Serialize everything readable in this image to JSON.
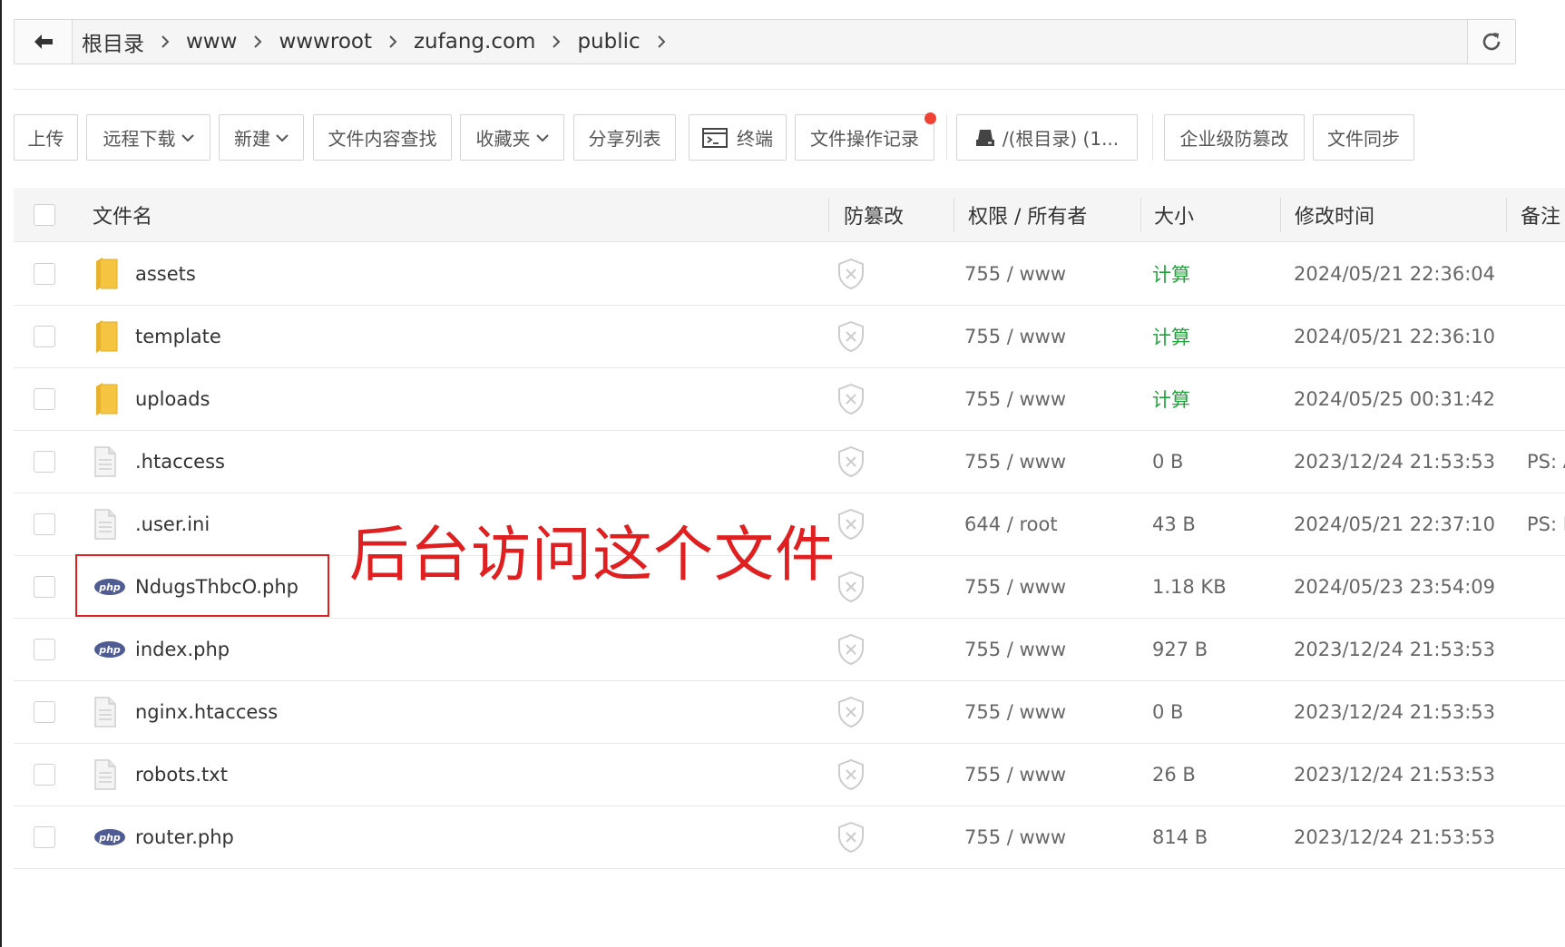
{
  "breadcrumb": {
    "items": [
      "根目录",
      "www",
      "wwwroot",
      "zufang.com",
      "public"
    ]
  },
  "toolbar": {
    "upload": "上传",
    "remote_download": "远程下载",
    "new": "新建",
    "content_search": "文件内容查找",
    "favorites": "收藏夹",
    "share_list": "分享列表",
    "terminal": "终端",
    "operation_log": "文件操作记录",
    "disk": "/(根目录) (1...",
    "tamper_proof": "企业级防篡改",
    "file_sync": "文件同步"
  },
  "table": {
    "headers": {
      "name": "文件名",
      "tamper": "防篡改",
      "perm": "权限 / 所有者",
      "size": "大小",
      "mtime": "修改时间",
      "note": "备注"
    },
    "rows": [
      {
        "icon": "folder-icon",
        "name": "assets",
        "perm": "755 / www",
        "size": "计算",
        "mtime": "2024/05/21 22:36:04",
        "note": ""
      },
      {
        "icon": "folder-icon",
        "name": "template",
        "perm": "755 / www",
        "size": "计算",
        "mtime": "2024/05/21 22:36:10",
        "note": ""
      },
      {
        "icon": "folder-icon",
        "name": "uploads",
        "perm": "755 / www",
        "size": "计算",
        "mtime": "2024/05/25 00:31:42",
        "note": ""
      },
      {
        "icon": "text-file-icon",
        "name": ".htaccess",
        "perm": "755 / www",
        "size": "0 B",
        "mtime": "2023/12/24 21:53:53",
        "note": "PS: A"
      },
      {
        "icon": "text-file-icon",
        "name": ".user.ini",
        "perm": "644 / root",
        "size": "43 B",
        "mtime": "2024/05/21 22:37:10",
        "note": "PS: F"
      },
      {
        "icon": "php-file-icon",
        "name": "NdugsThbcO.php",
        "perm": "755 / www",
        "size": "1.18 KB",
        "mtime": "2024/05/23 23:54:09",
        "note": ""
      },
      {
        "icon": "php-file-icon",
        "name": "index.php",
        "perm": "755 / www",
        "size": "927 B",
        "mtime": "2023/12/24 21:53:53",
        "note": ""
      },
      {
        "icon": "text-file-icon",
        "name": "nginx.htaccess",
        "perm": "755 / www",
        "size": "0 B",
        "mtime": "2023/12/24 21:53:53",
        "note": ""
      },
      {
        "icon": "text-file-icon",
        "name": "robots.txt",
        "perm": "755 / www",
        "size": "26 B",
        "mtime": "2023/12/24 21:53:53",
        "note": ""
      },
      {
        "icon": "php-file-icon",
        "name": "router.php",
        "perm": "755 / www",
        "size": "814 B",
        "mtime": "2023/12/24 21:53:53",
        "note": ""
      }
    ]
  },
  "annotation": {
    "text": "后台访问这个文件"
  },
  "colors": {
    "accent_green": "#20a53a",
    "annotation_red": "#e02020",
    "notification_dot": "#f04134",
    "folder_yellow": "#f5c542",
    "php_blue": "#4f5b93"
  }
}
